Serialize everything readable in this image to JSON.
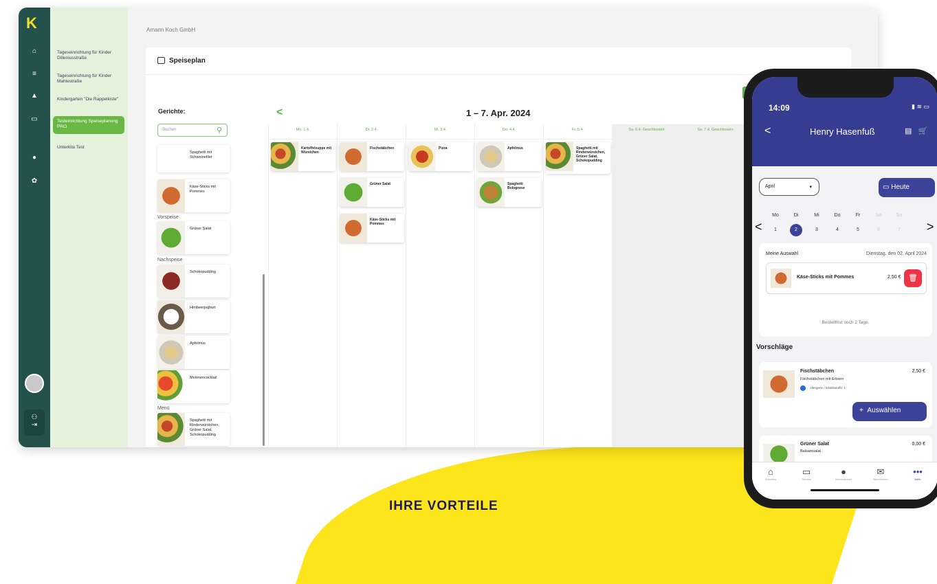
{
  "desktop": {
    "company": "Amann Koch GmbH",
    "sidebar": [
      {
        "label": "Tageseinrichtung für Kinder Dillenius­straße"
      },
      {
        "label": "Tageseinrichtung für Kinder Mahlestraße"
      },
      {
        "label": "Kindergarten \"Die Rappelkiste\""
      },
      {
        "label": "Testeinrichtung Speiseplanung PRO"
      },
      {
        "label": "Unterkita Test"
      }
    ],
    "card_title": "Speiseplan",
    "button1": "Ko",
    "dishes_heading": "Gerichte:",
    "search_placeholder": "Suchen",
    "dishes": [
      {
        "name": "Spaghetti mit Schweinefilet"
      },
      {
        "name": "Käse-Sticks mit Pommes"
      },
      {
        "name": "Grüner Salat"
      },
      {
        "name": "Schokopudding"
      },
      {
        "name": "Himbeerjoghurt"
      },
      {
        "name": "Apfelmus"
      },
      {
        "name": "Melonencocktail"
      },
      {
        "name": "Spaghetti mit Rinderwürstchen, Grüner Salat, Schokopudding"
      }
    ],
    "categories": {
      "vorspeise": "Vorspeise",
      "nachspeise": "Nachspeise",
      "menu": "Menü"
    },
    "week": "1 – 7. Apr. 2024",
    "days": [
      {
        "label": "Mo. 1.4."
      },
      {
        "label": "Di. 2.4."
      },
      {
        "label": "Mi. 3.4."
      },
      {
        "label": "Do. 4.4."
      },
      {
        "label": "Fr. 5.4."
      },
      {
        "label": "Sa. 6.4. Geschlossen"
      },
      {
        "label": "So. 7.4. Geschlossen"
      }
    ],
    "plan": {
      "mo": "Kartoffelsuppe mit Würstchen",
      "di1": "Fischstäbchen",
      "di2": "Grüner Salat",
      "di3": "Käse-Sticks mit Pommes",
      "mi": "Pizza",
      "do1": "Apfelmus",
      "do2": "Spaghetti Bolognese",
      "fr": "Spaghetti mit Rinderwürstchen, Grüner Salat, Schokopudding"
    }
  },
  "phone": {
    "time": "14:09",
    "user": "Henry Hasenfuß",
    "month": "April",
    "today": "Heute",
    "weekdays": [
      "Mo",
      "Di",
      "Mi",
      "Do",
      "Fr",
      "Sa",
      "So"
    ],
    "dates": [
      "1",
      "2",
      "3",
      "4",
      "5",
      "6",
      "7"
    ],
    "my_choice": "Meine Auswahl",
    "date_text": "Dienstag, den 02. April 2024",
    "chosen": "Käse-Sticks mit Pommes",
    "chosen_price": "2,50 €",
    "deadline": "Bestellfrist noch 2 Tage.",
    "suggestions": "Vorschläge",
    "s1_name": "Fischstäbchen",
    "s1_desc": "Fischstäbchen mit Erbsen",
    "s1_allergen": "Allergene / Inhaltsstoffe: 1",
    "s1_price": "2,50 €",
    "select": "Auswählen",
    "s2_name": "Grüner Salat",
    "s2_desc": "Balsamsalat",
    "s2_price": "0,00 €",
    "tabs": [
      "Aktuelles",
      "Termine",
      "Informationen",
      "Nachrichten",
      "Mehr"
    ]
  },
  "banner": "IHRE VORTEILE"
}
